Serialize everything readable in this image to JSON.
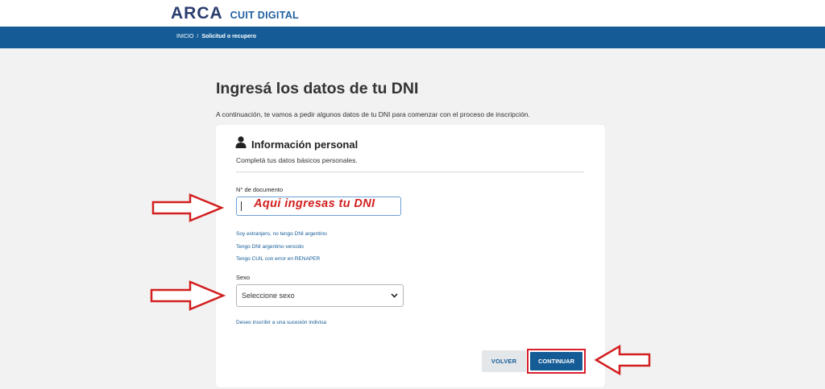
{
  "header": {
    "logo_main": "ARCA",
    "logo_sub": "CUIT DIGITAL"
  },
  "breadcrumb": {
    "home": "INICIO",
    "separator": "/",
    "current": "Solicitud o recupero"
  },
  "page": {
    "title": "Ingresá los datos de tu DNI",
    "intro": "A continuación, te vamos a pedir algunos datos de tu DNI para comenzar con el proceso de inscripción."
  },
  "card": {
    "icon": "user-icon",
    "title": "Información personal",
    "subtitle": "Completá tus datos básicos personales.",
    "document_label": "N° de documento",
    "document_value": "",
    "document_overlay_note": "Aqui ingresas tu DNI",
    "links": [
      "Soy extranjero, no tengo DNI argentino",
      "Tengo DNI argentino vencido",
      "Tengo CUIL con error en RENAPER"
    ],
    "sexo_label": "Sexo",
    "sexo_selected": "Seleccione sexo",
    "succession_link": "Deseo inscribir a una sucesión indivisa"
  },
  "actions": {
    "back": "VOLVER",
    "continue": "CONTINUAR"
  },
  "colors": {
    "navbar": "#155c97",
    "accent": "#155c97",
    "annotation": "#d21f1f",
    "highlight_border": "#d8202f"
  }
}
